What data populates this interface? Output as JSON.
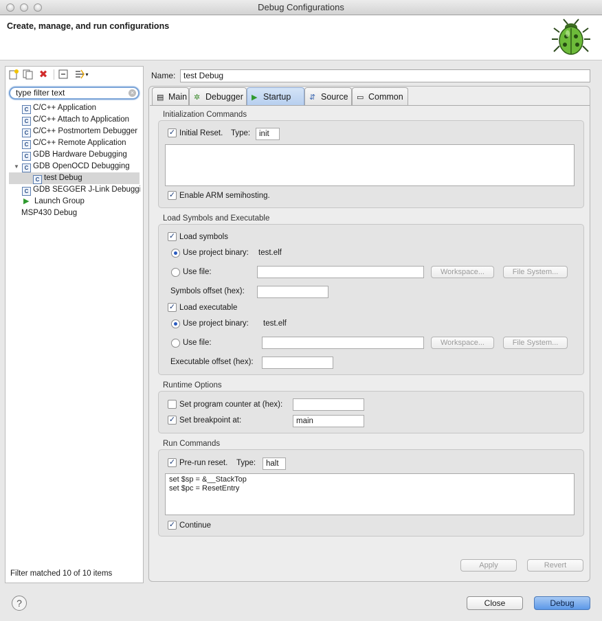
{
  "window": {
    "title": "Debug Configurations"
  },
  "header": {
    "title": "Create, manage, and run configurations"
  },
  "sidebar": {
    "filter_placeholder": "type filter text",
    "items": [
      {
        "label": "C/C++ Application",
        "icon": "c-config-icon"
      },
      {
        "label": "C/C++ Attach to Application",
        "icon": "c-config-icon"
      },
      {
        "label": "C/C++ Postmortem Debugger",
        "icon": "c-config-icon"
      },
      {
        "label": "C/C++ Remote Application",
        "icon": "c-config-icon"
      },
      {
        "label": "GDB Hardware Debugging",
        "icon": "c-config-icon"
      },
      {
        "label": "GDB OpenOCD Debugging",
        "icon": "c-config-icon",
        "expanded": true
      },
      {
        "label": "test Debug",
        "icon": "c-config-icon",
        "selected": true
      },
      {
        "label": "GDB SEGGER J-Link Debugging",
        "icon": "c-config-icon"
      },
      {
        "label": "Launch Group",
        "icon": "launch-icon"
      },
      {
        "label": "MSP430 Debug",
        "icon": ""
      }
    ],
    "status": "Filter matched 10 of 10 items"
  },
  "config": {
    "name_label": "Name:",
    "name_value": "test Debug"
  },
  "tabs": [
    {
      "label": "Main",
      "icon": "main-tab-icon"
    },
    {
      "label": "Debugger",
      "icon": "debugger-tab-icon"
    },
    {
      "label": "Startup",
      "icon": "startup-tab-icon",
      "active": true
    },
    {
      "label": "Source",
      "icon": "source-tab-icon"
    },
    {
      "label": "Common",
      "icon": "common-tab-icon"
    }
  ],
  "startup": {
    "init": {
      "title": "Initialization Commands",
      "initial_reset_label": "Initial Reset.",
      "initial_reset_checked": true,
      "type_label": "Type:",
      "type_value": "init",
      "commands": "",
      "semihosting_label": "Enable ARM semihosting.",
      "semihosting_checked": true
    },
    "load": {
      "title": "Load Symbols and Executable",
      "load_symbols_label": "Load symbols",
      "load_symbols_checked": true,
      "use_project_binary_label": "Use project binary:",
      "symbols_binary": "test.elf",
      "use_file_label": "Use file:",
      "workspace_label": "Workspace...",
      "filesystem_label": "File System...",
      "symbols_offset_label": "Symbols offset (hex):",
      "symbols_offset": "",
      "load_executable_label": "Load executable",
      "load_executable_checked": true,
      "executable_binary": "test.elf",
      "executable_offset_label": "Executable offset (hex):",
      "executable_offset": ""
    },
    "runtime": {
      "title": "Runtime Options",
      "set_pc_label": "Set program counter at (hex):",
      "set_pc_checked": false,
      "set_pc_value": "",
      "set_bp_label": "Set breakpoint at:",
      "set_bp_checked": true,
      "set_bp_value": "main"
    },
    "run": {
      "title": "Run Commands",
      "prerun_reset_label": "Pre-run reset.",
      "prerun_reset_checked": true,
      "type_label": "Type:",
      "type_value": "halt",
      "commands": "set $sp = &__StackTop\nset $pc = ResetEntry",
      "continue_label": "Continue",
      "continue_checked": true
    }
  },
  "buttons": {
    "apply": "Apply",
    "revert": "Revert",
    "close": "Close",
    "debug": "Debug",
    "help": "?"
  },
  "colors": {
    "accent": "#5c98e8",
    "selection": "#d6d6d6",
    "tab_active": "#b7cfef"
  }
}
